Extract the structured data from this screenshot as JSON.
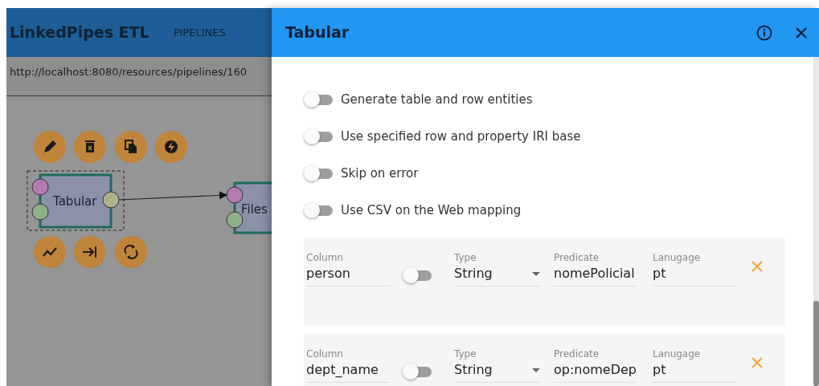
{
  "app": {
    "title": "LinkedPipes ETL",
    "nav": [
      {
        "label": "PIPELINES"
      }
    ],
    "url": "http://localhost:8080/resources/pipelines/160"
  },
  "canvas": {
    "components": [
      {
        "label": "Tabular",
        "selected": true
      },
      {
        "label": "Files",
        "selected": false
      }
    ]
  },
  "dialog": {
    "title": "Tabular",
    "options": [
      {
        "label": "Generate table and row entities",
        "on": false
      },
      {
        "label": "Use specified row and property IRI base",
        "on": false
      },
      {
        "label": "Skip on error",
        "on": false
      },
      {
        "label": "Use CSV on the Web mapping",
        "on": false
      }
    ],
    "mappings": [
      {
        "column_label": "Column",
        "column": "person",
        "on": false,
        "type_label": "Type",
        "type": "String",
        "predicate_label": "Predicate",
        "predicate": "nomePolicial",
        "language_label": "Lanugage",
        "language": "pt"
      },
      {
        "column_label": "Column",
        "column": "dept_name",
        "on": false,
        "type_label": "Type",
        "type": "String",
        "predicate_label": "Predicate",
        "predicate": "op:nomeDep",
        "language_label": "Lanugage",
        "language": "pt"
      }
    ]
  }
}
